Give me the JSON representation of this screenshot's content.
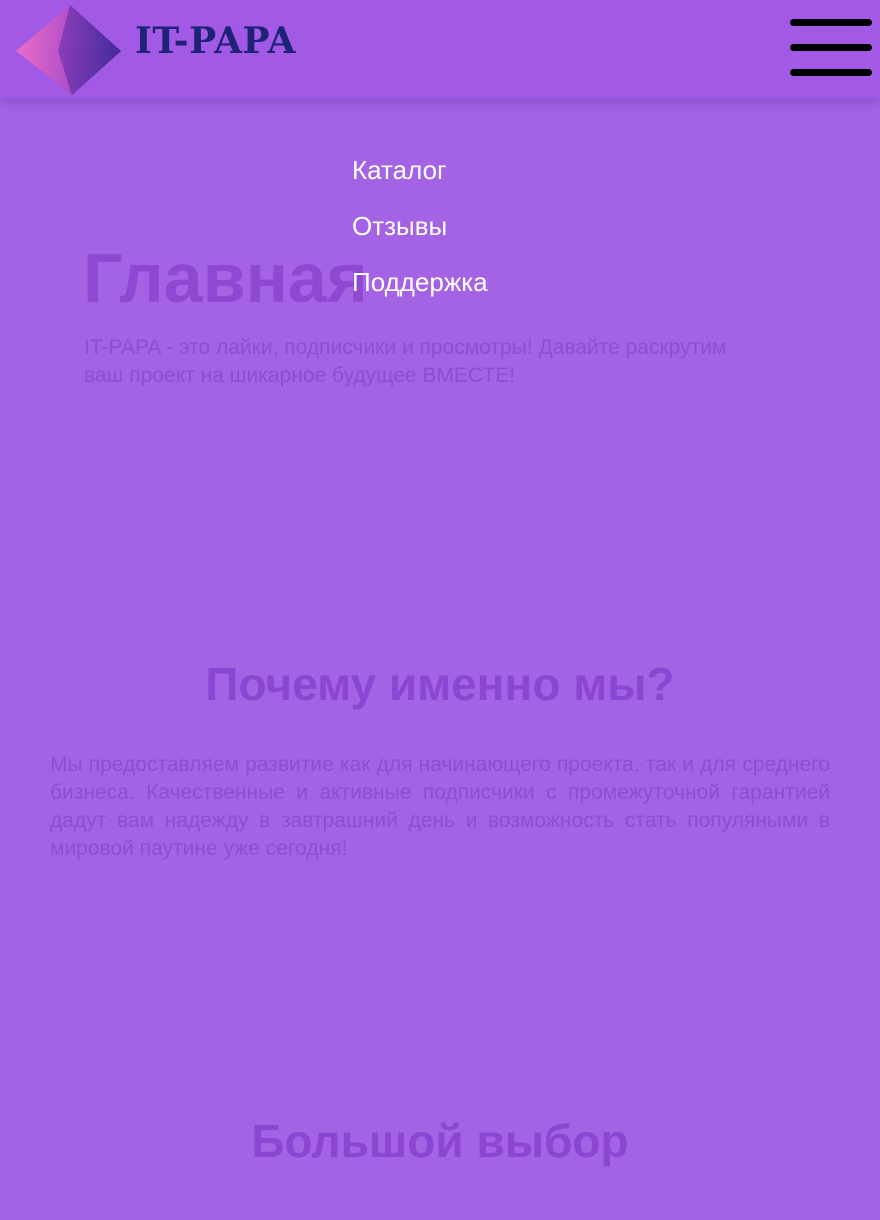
{
  "header": {
    "logo_text": "IT-PAPA",
    "logo_icon": "gradient-cube-icon",
    "menu_icon": "hamburger-menu-icon"
  },
  "nav": {
    "items": [
      {
        "label": "Каталог"
      },
      {
        "label": "Отзывы"
      },
      {
        "label": "Поддержка"
      }
    ]
  },
  "hero": {
    "title": "Главная",
    "text": "IT-PAPA - это лайки, подписчики и просмотры! Давайте раскрутим ваш проект на шикарное будущее ВМЕСТЕ!"
  },
  "why": {
    "title": "Почему именно мы?",
    "text": "Мы предоставляем развитие как для начинающего проекта, так и для среднего бизнеса. Качественные и активные подписчики с промежуточной гарантией дадут вам надежду в завтрашний день и возможность стать популяными в мировой паутине уже сегодня!"
  },
  "choice": {
    "title": "Большой выбор"
  },
  "colors": {
    "background": "#a463e5",
    "header": "#a259e6",
    "heading": "#8b46d2",
    "logo_text": "#1f2378",
    "nav_text": "#ffffff"
  }
}
